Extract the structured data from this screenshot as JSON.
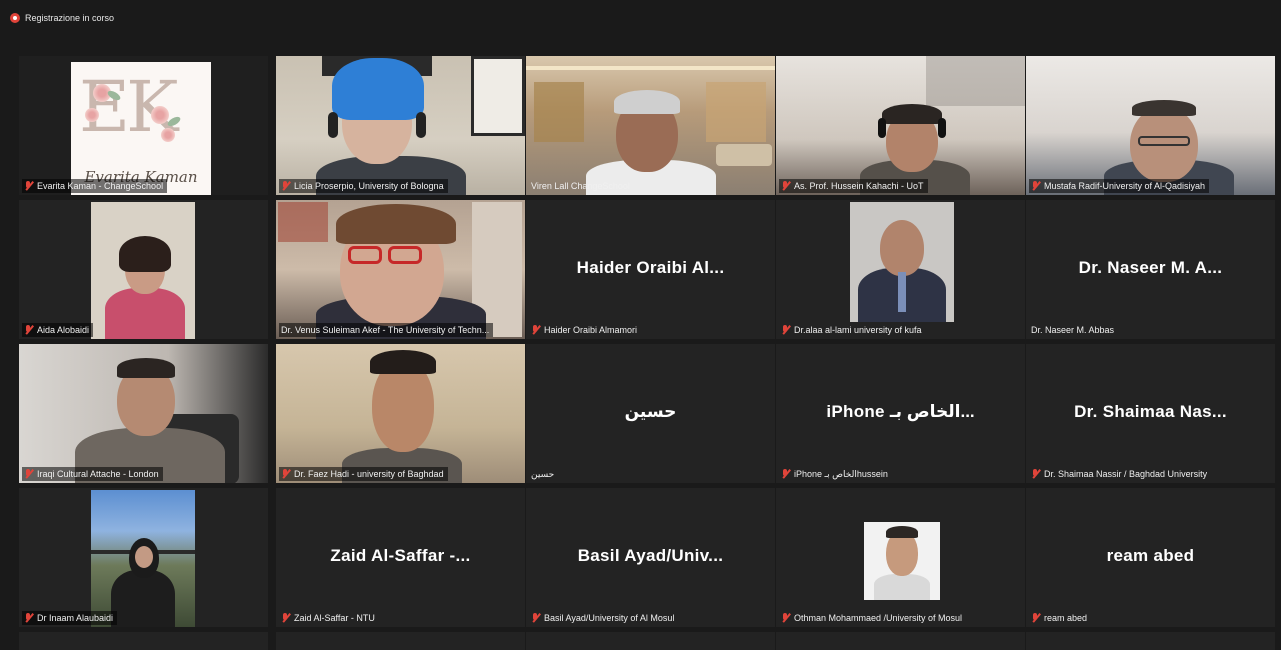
{
  "recording": {
    "label": "Registrazione in corso"
  },
  "participants": [
    {
      "display_name": "Evarita Kaman - ChangeSchool",
      "tile_text": "",
      "logo_text": "Evarita Kaman",
      "logo_letters": "EK",
      "muted": true
    },
    {
      "display_name": "Licia Proserpio, University of Bologna",
      "tile_text": "",
      "muted": true
    },
    {
      "display_name": "Viren Lall ChangeSchool",
      "tile_text": "",
      "muted": false
    },
    {
      "display_name": "As. Prof. Hussein Kahachi - UoT",
      "tile_text": "",
      "muted": true
    },
    {
      "display_name": "Mustafa Radif-University of Al-Qadisiyah",
      "tile_text": "",
      "muted": true
    },
    {
      "display_name": "Aida Alobaidi",
      "tile_text": "",
      "muted": true
    },
    {
      "display_name": "Dr. Venus Suleiman Akef - The University of Techn...",
      "tile_text": "",
      "muted": false,
      "active_speaker": true
    },
    {
      "display_name": "Haider Oraibi Almamori",
      "tile_text": "Haider Oraibi Al...",
      "muted": true
    },
    {
      "display_name": "Dr.alaa al-lami university of kufa",
      "tile_text": "",
      "muted": true
    },
    {
      "display_name": "Dr. Naseer M. Abbas",
      "tile_text": "Dr. Naseer M. A...",
      "muted": false
    },
    {
      "display_name": "Iraqi Cultural Attache - London",
      "tile_text": "",
      "muted": true
    },
    {
      "display_name": "Dr. Faez Hadi - university of Baghdad",
      "tile_text": "",
      "muted": true
    },
    {
      "display_name": "حسين",
      "tile_text": "حسين",
      "muted": false
    },
    {
      "display_name": "iPhone الخاص بـhussein",
      "tile_text": "iPhone الخاص بـ...",
      "muted": true
    },
    {
      "display_name": "Dr. Shaimaa Nassir / Baghdad University",
      "tile_text": "Dr. Shaimaa Nas...",
      "muted": true
    },
    {
      "display_name": "Dr Inaam Alaubaidi",
      "tile_text": "",
      "muted": true
    },
    {
      "display_name": "Zaid Al-Saffar - NTU",
      "tile_text": "Zaid Al-Saffar -...",
      "muted": true
    },
    {
      "display_name": "Basil Ayad/University of Al Mosul",
      "tile_text": "Basil Ayad/Univ...",
      "muted": true
    },
    {
      "display_name": "Othman Mohammaed /University of Mosul",
      "tile_text": "",
      "muted": true
    },
    {
      "display_name": "ream abed",
      "tile_text": "ream abed",
      "muted": true
    }
  ],
  "colors": {
    "background": "#1a1a1a",
    "tile": "#232323",
    "active_speaker_border": "#b9d25a",
    "mute": "#e0443a"
  }
}
